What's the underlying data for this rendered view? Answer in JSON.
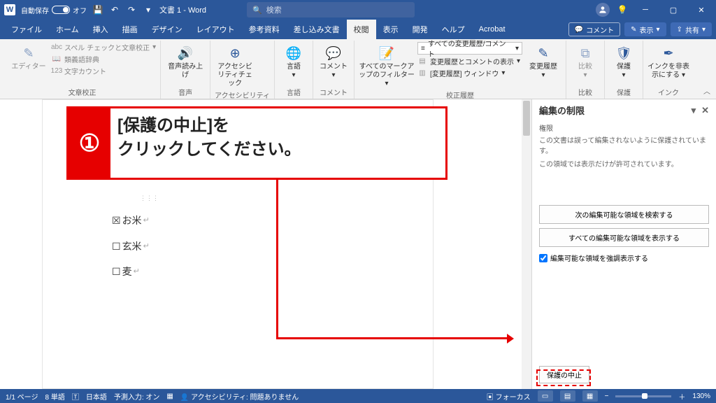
{
  "titleBar": {
    "autosave_label": "自動保存",
    "autosave_state": "オフ",
    "doc_title": "文書 1  -  Word",
    "search_placeholder": "検索"
  },
  "tabs": {
    "file": "ファイル",
    "home": "ホーム",
    "insert": "挿入",
    "draw": "描画",
    "design": "デザイン",
    "layout": "レイアウト",
    "references": "参考資料",
    "mailings": "差し込み文書",
    "review": "校閲",
    "view": "表示",
    "developer": "開発",
    "help": "ヘルプ",
    "acrobat": "Acrobat"
  },
  "tabsRight": {
    "comment": "コメント",
    "display": "表示",
    "share": "共有"
  },
  "ribbon": {
    "proofing": {
      "editor": "エディター",
      "spell": "スペル チェックと文章校正",
      "thesaurus": "類義語辞典",
      "wordcount": "文字カウント",
      "group": "文章校正"
    },
    "speech": {
      "read_aloud": "音声読み上げ",
      "group": "音声"
    },
    "accessibility": {
      "check": "アクセシビリティチェック",
      "group": "アクセシビリティ"
    },
    "language": {
      "lang": "言語",
      "group": "言語"
    },
    "comments": {
      "comment": "コメント",
      "group": "コメント"
    },
    "tracking": {
      "markup_filter": "すべてのマークアップのフィルター",
      "combo": "すべての変更履歴/コメント",
      "show_changes": "変更履歴とコメントの表示",
      "pane": "[変更履歴] ウィンドウ",
      "track": "変更履歴",
      "group": "校正履歴"
    },
    "compare": {
      "compare": "比較",
      "group": "比較"
    },
    "protect": {
      "protect": "保護",
      "group": "保護"
    },
    "ink": {
      "hide": "インクを非表示にする",
      "group": "インク"
    }
  },
  "annotation": {
    "num": "①",
    "line1": "[保護の中止]を",
    "line2": "クリックしてください。"
  },
  "document": {
    "items": [
      {
        "mark": "☒",
        "text": "お米"
      },
      {
        "mark": "☐",
        "text": "玄米"
      },
      {
        "mark": "☐",
        "text": "麦"
      }
    ]
  },
  "pane": {
    "title": "編集の制限",
    "subhead": "権限",
    "desc1": "この文書は誤って編集されないように保護されています。",
    "desc2": "この領域では表示だけが許可されています。",
    "btn_next": "次の編集可能な領域を検索する",
    "btn_all": "すべての編集可能な領域を表示する",
    "chk_highlight": "編集可能な領域を強調表示する",
    "stop": "保護の中止"
  },
  "status": {
    "page": "1/1 ページ",
    "words": "8 単語",
    "lang": "日本語",
    "ime": "予測入力: オン",
    "a11y": "アクセシビリティ: 問題ありません",
    "focus": "フォーカス",
    "zoom": "130%"
  }
}
